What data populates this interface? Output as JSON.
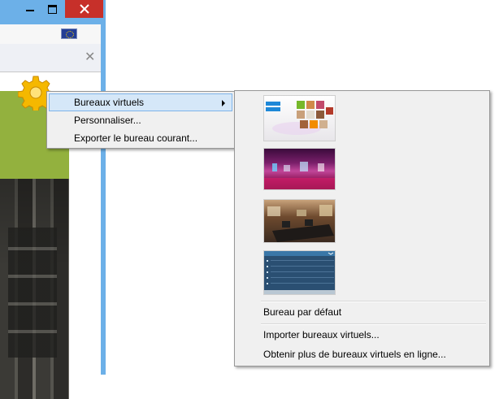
{
  "context_menu": {
    "items": [
      {
        "label": "Bureaux virtuels",
        "has_submenu": true,
        "highlighted": true
      },
      {
        "label": "Personnaliser..."
      },
      {
        "label": "Exporter le bureau courant..."
      }
    ]
  },
  "submenu": {
    "thumbnails": [
      {
        "icon": "desktop-thumbnail-mosaic-icon"
      },
      {
        "icon": "desktop-thumbnail-nightclub-icon"
      },
      {
        "icon": "desktop-thumbnail-office-icon"
      },
      {
        "icon": "desktop-thumbnail-list-icon"
      }
    ],
    "items": [
      {
        "label": "Bureau par défaut"
      },
      {
        "label": "Importer bureaux virtuels..."
      },
      {
        "label": "Obtenir plus de bureaux virtuels en ligne..."
      }
    ]
  },
  "colors": {
    "menu_bg": "#f0f0f0",
    "highlight": "#d5e7f8",
    "close_button": "#c7302a",
    "titlebar": "#6cb0e8"
  }
}
